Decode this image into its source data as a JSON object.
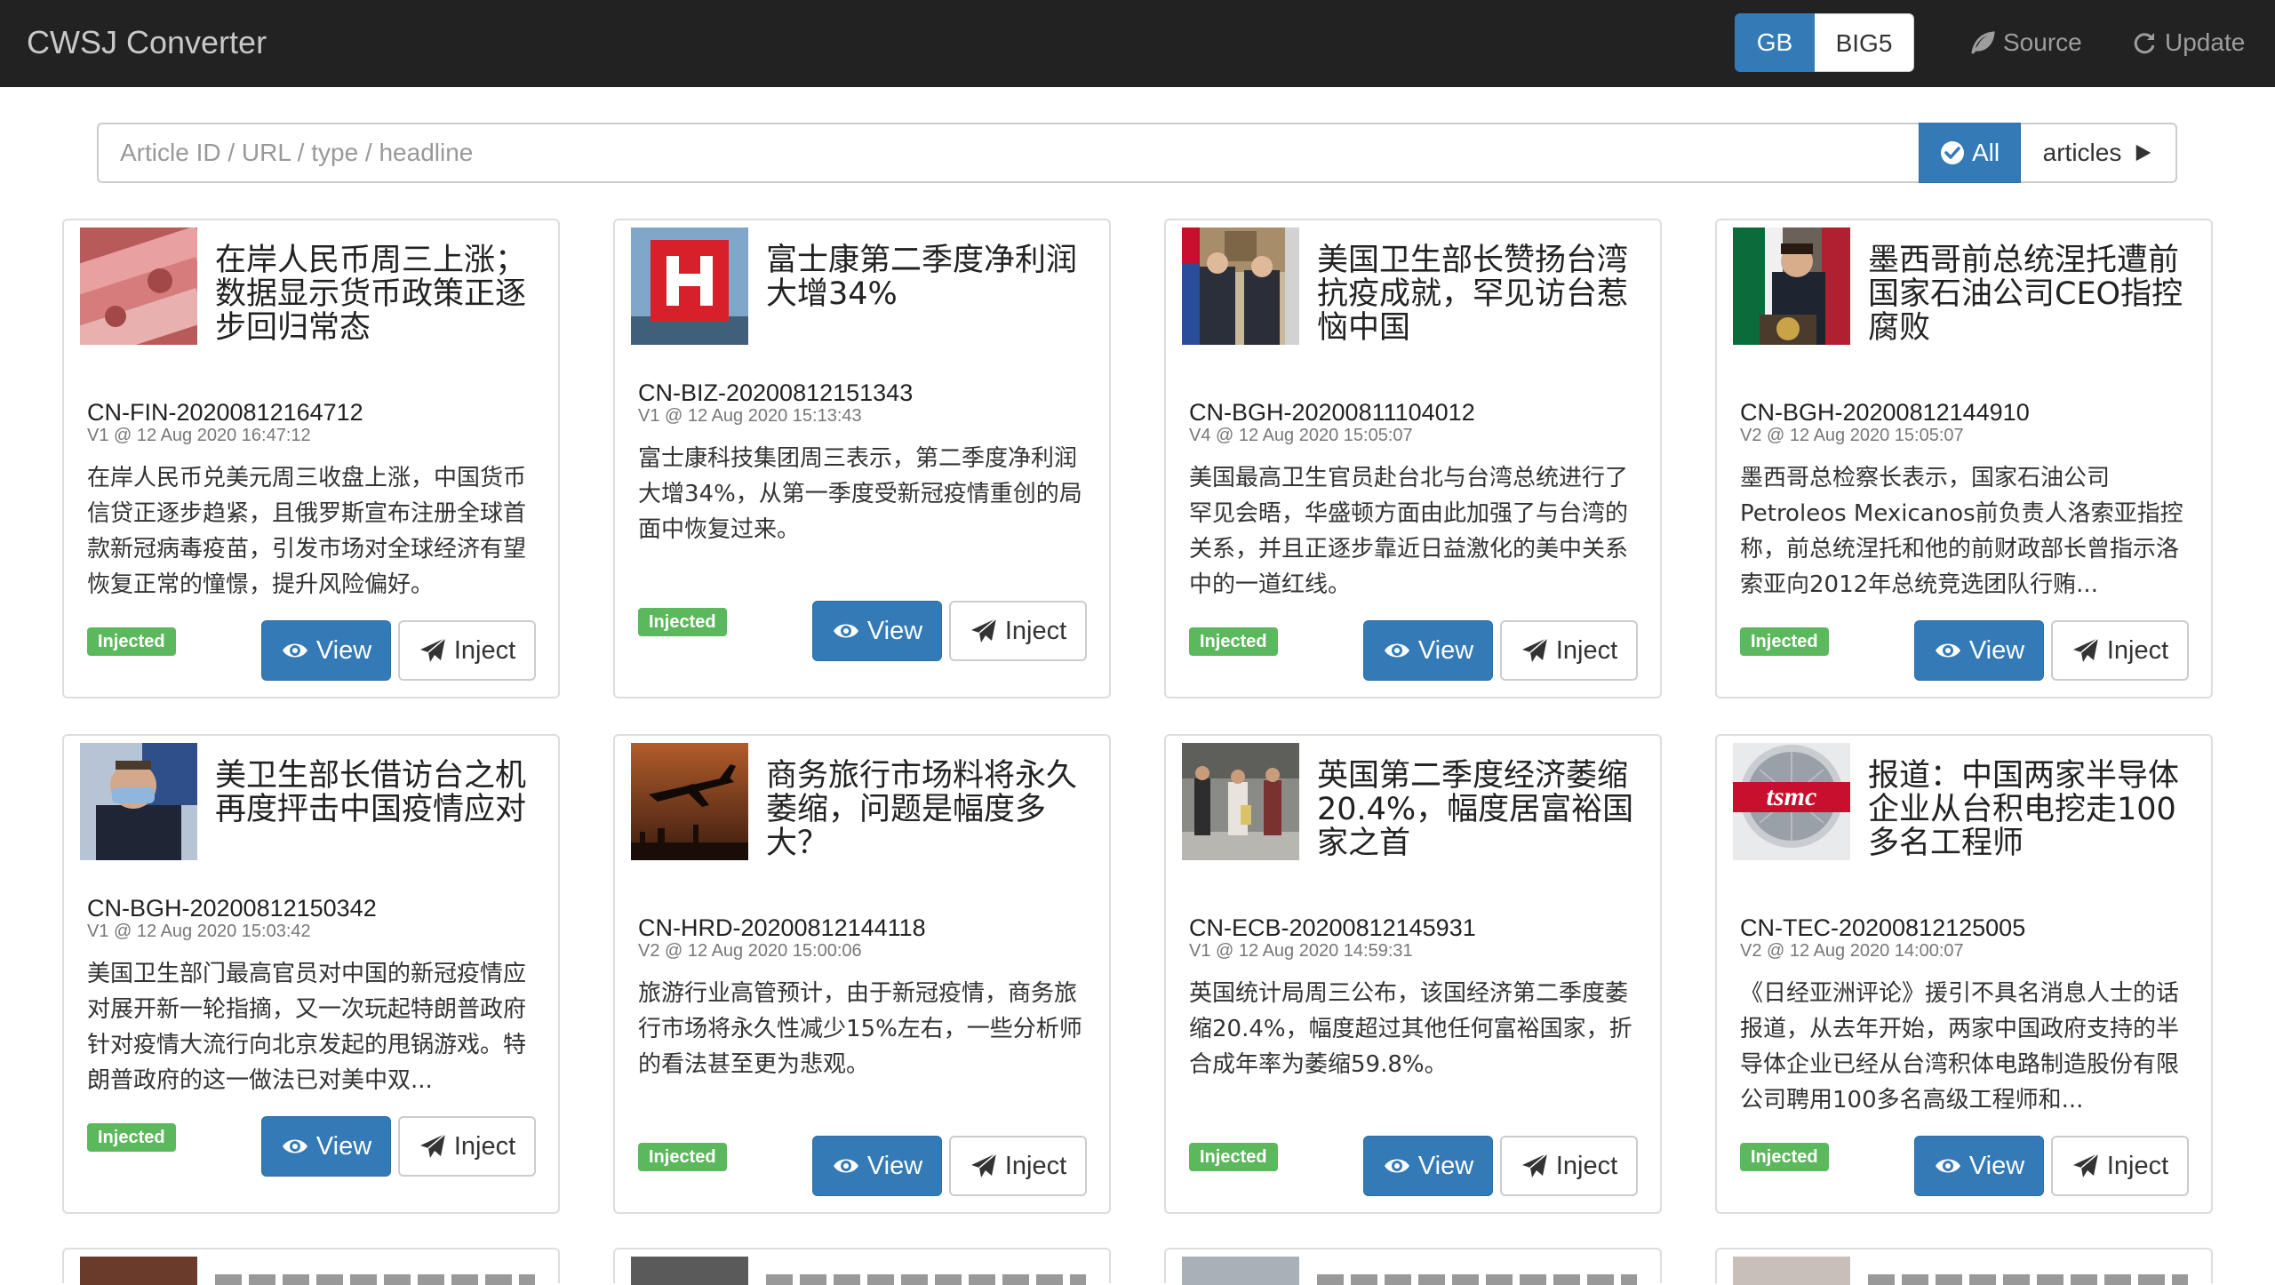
{
  "app": {
    "title": "CWSJ Converter"
  },
  "nav": {
    "lang_gb": "GB",
    "lang_big5": "BIG5",
    "source_label": "Source",
    "update_label": "Update"
  },
  "search": {
    "placeholder": "Article ID / URL / type / headline",
    "all_label": "All",
    "articles_label": "articles"
  },
  "colors": {
    "navbar": "#222222",
    "primary": "#337ab7",
    "success": "#5cb85c"
  },
  "cards": [
    {
      "headline": "在岸人民币周三上涨；数据显示货币政策正逐步回归常态",
      "id": "CN-FIN-20200812164712",
      "meta": "V1 @ 12 Aug 2020 16:47:12",
      "summary": "在岸人民币兑美元周三收盘上涨，中国货币信贷正逐步趋紧，且俄罗斯宣布注册全球首款新冠病毒疫苗，引发市场对全球经济有望恢复正常的憧憬，提升风险偏好。",
      "badge": "Injected",
      "view": "View",
      "inject": "Inject",
      "thumb": "banknotes"
    },
    {
      "headline": "富士康第二季度净利润大增34%",
      "id": "CN-BIZ-20200812151343",
      "meta": "V1 @ 12 Aug 2020 15:13:43",
      "summary": "富士康科技集团周三表示，第二季度净利润大增34%，从第一季度受新冠疫情重创的局面中恢复过来。",
      "badge": "Injected",
      "view": "View",
      "inject": "Inject",
      "thumb": "foxconn-logo"
    },
    {
      "headline": "美国卫生部长赞扬台湾抗疫成就，罕见访台惹恼中国",
      "id": "CN-BGH-20200811104012",
      "meta": "V4 @ 12 Aug 2020 15:05:07",
      "summary": "美国最高卫生官员赴台北与台湾总统进行了罕见会晤，华盛顿方面由此加强了与台湾的关系，并且正逐步靠近日益激化的美中关系中的一道红线。",
      "badge": "Injected",
      "view": "View",
      "inject": "Inject",
      "thumb": "meeting"
    },
    {
      "headline": "墨西哥前总统涅托遭前国家石油公司CEO指控腐败",
      "id": "CN-BGH-20200812144910",
      "meta": "V2 @ 12 Aug 2020 15:05:07",
      "summary": "墨西哥总检察长表示，国家石油公司Petroleos Mexicanos前负责人洛索亚指控称，前总统涅托和他的前财政部长曾指示洛索亚向2012年总统竞选团队行贿...",
      "badge": "Injected",
      "view": "View",
      "inject": "Inject",
      "thumb": "podium"
    },
    {
      "headline": "美卫生部长借访台之机再度抨击中国疫情应对",
      "id": "CN-BGH-20200812150342",
      "meta": "V1 @ 12 Aug 2020 15:03:42",
      "summary": "美国卫生部门最高官员对中国的新冠疫情应对展开新一轮指摘，又一次玩起特朗普政府针对疫情大流行向北京发起的甩锅游戏。特朗普政府的这一做法已对美中双...",
      "badge": "Injected",
      "view": "View",
      "inject": "Inject",
      "thumb": "masked-official"
    },
    {
      "headline": "商务旅行市场料将永久萎缩，问题是幅度多大？",
      "id": "CN-HRD-20200812144118",
      "meta": "V2 @ 12 Aug 2020 15:00:06",
      "summary": "旅游行业高管预计，由于新冠疫情，商务旅行市场将永久性减少15%左右，一些分析师的看法甚至更为悲观。",
      "badge": "Injected",
      "view": "View",
      "inject": "Inject",
      "thumb": "airplane"
    },
    {
      "headline": "英国第二季度经济萎缩20.4%，幅度居富裕国家之首",
      "id": "CN-ECB-20200812145931",
      "meta": "V1 @ 12 Aug 2020 14:59:31",
      "summary": "英国统计局周三公布，该国经济第二季度萎缩20.4%，幅度超过其他任何富裕国家，折合成年率为萎缩59.8%。",
      "badge": "Injected",
      "view": "View",
      "inject": "Inject",
      "thumb": "street"
    },
    {
      "headline": "报道：中国两家半导体企业从台积电挖走100多名工程师",
      "id": "CN-TEC-20200812125005",
      "meta": "V2 @ 12 Aug 2020 14:00:07",
      "summary": "《日经亚洲评论》援引不具名消息人士的话报道，从去年开始，两家中国政府支持的半导体企业已经从台湾积体电路制造股份有限公司聘用100多名高级工程师和...",
      "badge": "Injected",
      "view": "View",
      "inject": "Inject",
      "thumb": "tsmc-wafer"
    }
  ]
}
